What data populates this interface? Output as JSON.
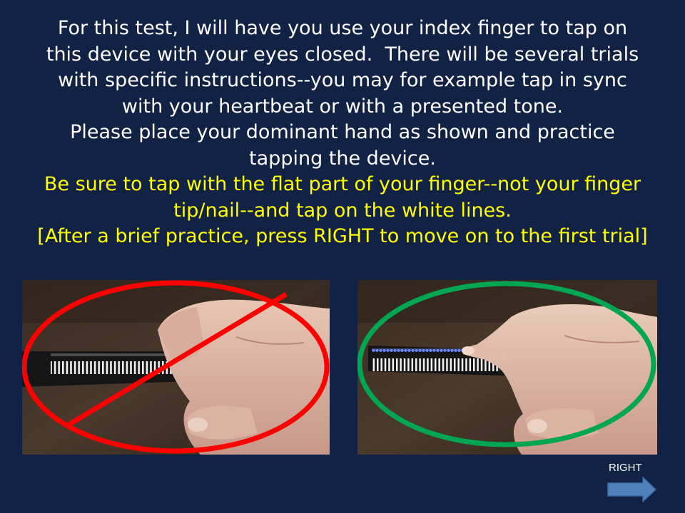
{
  "instructions": {
    "white_lines": [
      "For this test, I will have you use your index finger to tap on",
      "this device with your eyes closed.  There will be several trials",
      "with specific instructions--you may for example tap in sync",
      "with your heartbeat or with a presented tone.",
      "Please place your dominant hand as shown and practice",
      "tapping the device."
    ],
    "yellow_lines": [
      "Be sure to tap with the flat part of your finger--not your finger",
      "tip/nail--and tap on the white lines.",
      "[After a brief practice, press RIGHT to move on to the first trial]"
    ]
  },
  "examples": {
    "incorrect": {
      "marker": "prohibited-icon",
      "marker_color": "#ff0000"
    },
    "correct": {
      "marker": "approved-circle-icon",
      "marker_color": "#00a651"
    }
  },
  "navigation": {
    "right_label": "RIGHT",
    "right_arrow_color": "#4f81bd"
  },
  "colors": {
    "background": "#112244",
    "primary_text": "#ffffff",
    "highlight_text": "#ffff00"
  }
}
